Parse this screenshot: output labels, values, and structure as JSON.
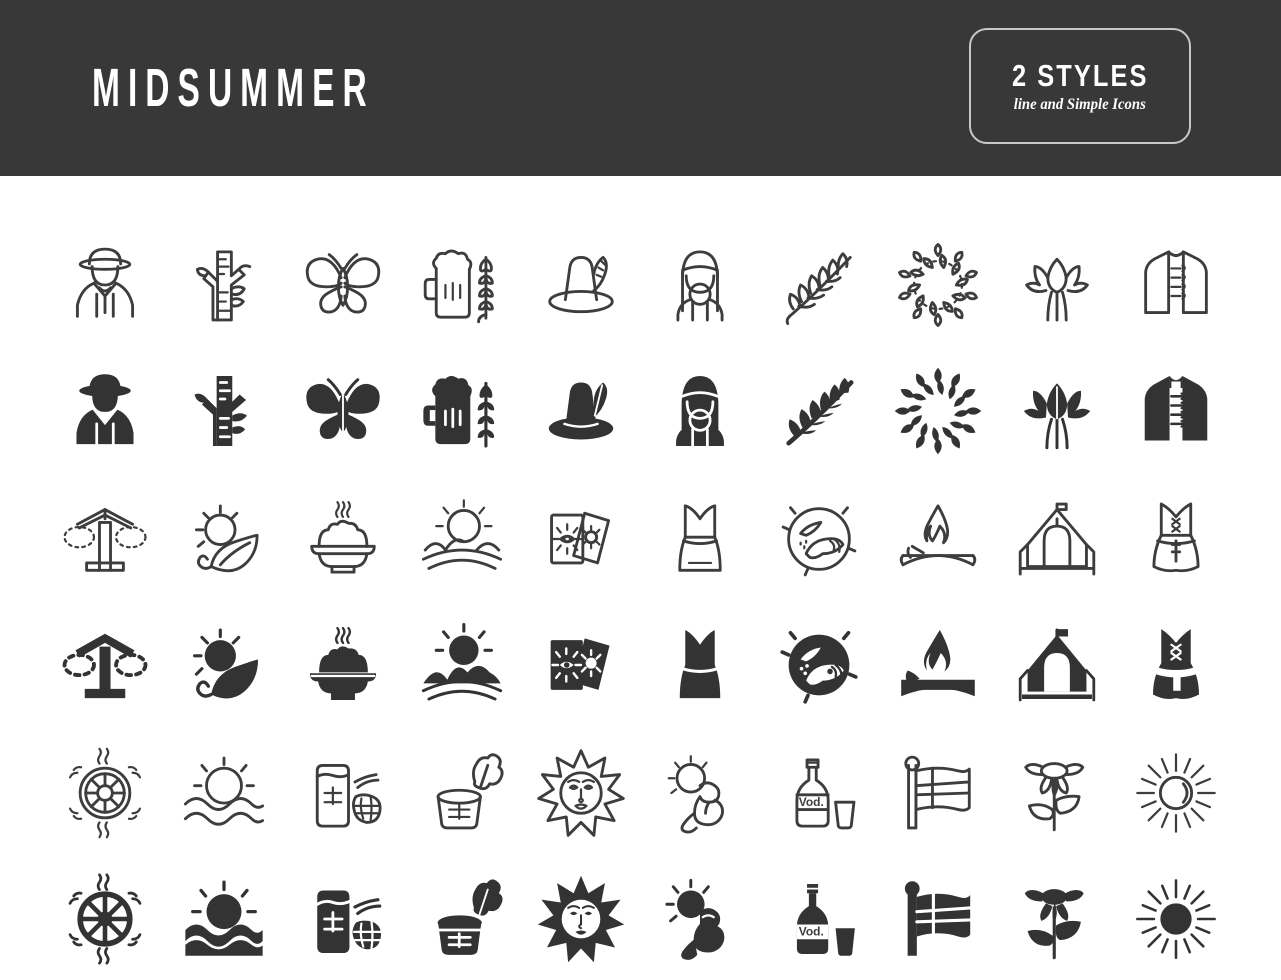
{
  "header": {
    "title": "MIDSUMMER",
    "background_color": "#383838",
    "text_color": "#ffffff",
    "badge": {
      "main": "2 STYLES",
      "sub": "line and Simple Icons",
      "border_color": "#c8c8c8"
    }
  },
  "grid": {
    "columns": 10,
    "icon_rows": 6,
    "styles": [
      "line",
      "simple"
    ],
    "line_color": "#3d3d3d",
    "solid_color": "#333333",
    "background_color": "#ffffff"
  },
  "icon_groups": [
    {
      "group": 1,
      "line_row_label": "line",
      "solid_row_label": "simple",
      "icons": [
        {
          "name": "man-in-hat-icon",
          "label": "Man in traditional hat"
        },
        {
          "name": "birch-tree-icon",
          "label": "Birch tree"
        },
        {
          "name": "butterfly-icon",
          "label": "Butterfly"
        },
        {
          "name": "beer-mug-wheat-icon",
          "label": "Beer mug with wheat"
        },
        {
          "name": "tyrolean-hat-icon",
          "label": "Tyrolean hat with feather"
        },
        {
          "name": "woman-headband-icon",
          "label": "Woman with headband"
        },
        {
          "name": "fern-leaf-icon",
          "label": "Fern leaf"
        },
        {
          "name": "laurel-wreath-icon",
          "label": "Laurel wreath"
        },
        {
          "name": "tulip-flowers-icon",
          "label": "Tulip flowers"
        },
        {
          "name": "folk-vest-icon",
          "label": "Traditional vest"
        }
      ]
    },
    {
      "group": 2,
      "line_row_label": "line",
      "solid_row_label": "simple",
      "icons": [
        {
          "name": "maypole-icon",
          "label": "Maypole with wreaths"
        },
        {
          "name": "sun-leaf-icon",
          "label": "Sun with leaf"
        },
        {
          "name": "hot-dish-icon",
          "label": "Hot dish bowl"
        },
        {
          "name": "sunrise-water-icon",
          "label": "Sunrise over water"
        },
        {
          "name": "tarot-cards-icon",
          "label": "Fortune telling cards"
        },
        {
          "name": "folk-dress-icon",
          "label": "Folk dress"
        },
        {
          "name": "midnight-sun-globe-icon",
          "label": "Midnight sun globe"
        },
        {
          "name": "bonfire-icon",
          "label": "Bonfire"
        },
        {
          "name": "festival-tent-icon",
          "label": "Festival tent"
        },
        {
          "name": "dirndl-dress-icon",
          "label": "Dirndl dress"
        }
      ]
    },
    {
      "group": 3,
      "line_row_label": "line",
      "solid_row_label": "simple",
      "icons": [
        {
          "name": "sun-wheel-icon",
          "label": "Sun wheel"
        },
        {
          "name": "sunset-sea-icon",
          "label": "Sunset over the sea"
        },
        {
          "name": "jam-jar-berry-icon",
          "label": "Jar with berries"
        },
        {
          "name": "sauna-bucket-icon",
          "label": "Sauna bucket with leaf"
        },
        {
          "name": "sun-face-icon",
          "label": "Sun with face"
        },
        {
          "name": "sunbathing-icon",
          "label": "Sunbathing"
        },
        {
          "name": "vodka-bottle-icon",
          "label": "Vodka bottle and glass",
          "bottle_label": "Vod."
        },
        {
          "name": "nordic-flag-icon",
          "label": "Nordic cross flag"
        },
        {
          "name": "daisy-flower-icon",
          "label": "Daisy flower"
        },
        {
          "name": "sun-rays-icon",
          "label": "Sun with rays"
        }
      ]
    }
  ]
}
